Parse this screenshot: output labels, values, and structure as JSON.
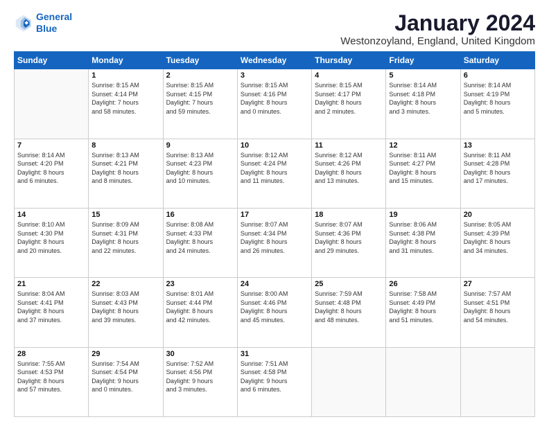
{
  "logo": {
    "line1": "General",
    "line2": "Blue"
  },
  "header": {
    "title": "January 2024",
    "location": "Westonzoyland, England, United Kingdom"
  },
  "weekdays": [
    "Sunday",
    "Monday",
    "Tuesday",
    "Wednesday",
    "Thursday",
    "Friday",
    "Saturday"
  ],
  "weeks": [
    [
      {
        "day": "",
        "sunrise": "",
        "sunset": "",
        "daylight": ""
      },
      {
        "day": "1",
        "sunrise": "Sunrise: 8:15 AM",
        "sunset": "Sunset: 4:14 PM",
        "daylight": "Daylight: 7 hours and 58 minutes."
      },
      {
        "day": "2",
        "sunrise": "Sunrise: 8:15 AM",
        "sunset": "Sunset: 4:15 PM",
        "daylight": "Daylight: 7 hours and 59 minutes."
      },
      {
        "day": "3",
        "sunrise": "Sunrise: 8:15 AM",
        "sunset": "Sunset: 4:16 PM",
        "daylight": "Daylight: 8 hours and 0 minutes."
      },
      {
        "day": "4",
        "sunrise": "Sunrise: 8:15 AM",
        "sunset": "Sunset: 4:17 PM",
        "daylight": "Daylight: 8 hours and 2 minutes."
      },
      {
        "day": "5",
        "sunrise": "Sunrise: 8:14 AM",
        "sunset": "Sunset: 4:18 PM",
        "daylight": "Daylight: 8 hours and 3 minutes."
      },
      {
        "day": "6",
        "sunrise": "Sunrise: 8:14 AM",
        "sunset": "Sunset: 4:19 PM",
        "daylight": "Daylight: 8 hours and 5 minutes."
      }
    ],
    [
      {
        "day": "7",
        "sunrise": "Sunrise: 8:14 AM",
        "sunset": "Sunset: 4:20 PM",
        "daylight": "Daylight: 8 hours and 6 minutes."
      },
      {
        "day": "8",
        "sunrise": "Sunrise: 8:13 AM",
        "sunset": "Sunset: 4:21 PM",
        "daylight": "Daylight: 8 hours and 8 minutes."
      },
      {
        "day": "9",
        "sunrise": "Sunrise: 8:13 AM",
        "sunset": "Sunset: 4:23 PM",
        "daylight": "Daylight: 8 hours and 10 minutes."
      },
      {
        "day": "10",
        "sunrise": "Sunrise: 8:12 AM",
        "sunset": "Sunset: 4:24 PM",
        "daylight": "Daylight: 8 hours and 11 minutes."
      },
      {
        "day": "11",
        "sunrise": "Sunrise: 8:12 AM",
        "sunset": "Sunset: 4:26 PM",
        "daylight": "Daylight: 8 hours and 13 minutes."
      },
      {
        "day": "12",
        "sunrise": "Sunrise: 8:11 AM",
        "sunset": "Sunset: 4:27 PM",
        "daylight": "Daylight: 8 hours and 15 minutes."
      },
      {
        "day": "13",
        "sunrise": "Sunrise: 8:11 AM",
        "sunset": "Sunset: 4:28 PM",
        "daylight": "Daylight: 8 hours and 17 minutes."
      }
    ],
    [
      {
        "day": "14",
        "sunrise": "Sunrise: 8:10 AM",
        "sunset": "Sunset: 4:30 PM",
        "daylight": "Daylight: 8 hours and 20 minutes."
      },
      {
        "day": "15",
        "sunrise": "Sunrise: 8:09 AM",
        "sunset": "Sunset: 4:31 PM",
        "daylight": "Daylight: 8 hours and 22 minutes."
      },
      {
        "day": "16",
        "sunrise": "Sunrise: 8:08 AM",
        "sunset": "Sunset: 4:33 PM",
        "daylight": "Daylight: 8 hours and 24 minutes."
      },
      {
        "day": "17",
        "sunrise": "Sunrise: 8:07 AM",
        "sunset": "Sunset: 4:34 PM",
        "daylight": "Daylight: 8 hours and 26 minutes."
      },
      {
        "day": "18",
        "sunrise": "Sunrise: 8:07 AM",
        "sunset": "Sunset: 4:36 PM",
        "daylight": "Daylight: 8 hours and 29 minutes."
      },
      {
        "day": "19",
        "sunrise": "Sunrise: 8:06 AM",
        "sunset": "Sunset: 4:38 PM",
        "daylight": "Daylight: 8 hours and 31 minutes."
      },
      {
        "day": "20",
        "sunrise": "Sunrise: 8:05 AM",
        "sunset": "Sunset: 4:39 PM",
        "daylight": "Daylight: 8 hours and 34 minutes."
      }
    ],
    [
      {
        "day": "21",
        "sunrise": "Sunrise: 8:04 AM",
        "sunset": "Sunset: 4:41 PM",
        "daylight": "Daylight: 8 hours and 37 minutes."
      },
      {
        "day": "22",
        "sunrise": "Sunrise: 8:03 AM",
        "sunset": "Sunset: 4:43 PM",
        "daylight": "Daylight: 8 hours and 39 minutes."
      },
      {
        "day": "23",
        "sunrise": "Sunrise: 8:01 AM",
        "sunset": "Sunset: 4:44 PM",
        "daylight": "Daylight: 8 hours and 42 minutes."
      },
      {
        "day": "24",
        "sunrise": "Sunrise: 8:00 AM",
        "sunset": "Sunset: 4:46 PM",
        "daylight": "Daylight: 8 hours and 45 minutes."
      },
      {
        "day": "25",
        "sunrise": "Sunrise: 7:59 AM",
        "sunset": "Sunset: 4:48 PM",
        "daylight": "Daylight: 8 hours and 48 minutes."
      },
      {
        "day": "26",
        "sunrise": "Sunrise: 7:58 AM",
        "sunset": "Sunset: 4:49 PM",
        "daylight": "Daylight: 8 hours and 51 minutes."
      },
      {
        "day": "27",
        "sunrise": "Sunrise: 7:57 AM",
        "sunset": "Sunset: 4:51 PM",
        "daylight": "Daylight: 8 hours and 54 minutes."
      }
    ],
    [
      {
        "day": "28",
        "sunrise": "Sunrise: 7:55 AM",
        "sunset": "Sunset: 4:53 PM",
        "daylight": "Daylight: 8 hours and 57 minutes."
      },
      {
        "day": "29",
        "sunrise": "Sunrise: 7:54 AM",
        "sunset": "Sunset: 4:54 PM",
        "daylight": "Daylight: 9 hours and 0 minutes."
      },
      {
        "day": "30",
        "sunrise": "Sunrise: 7:52 AM",
        "sunset": "Sunset: 4:56 PM",
        "daylight": "Daylight: 9 hours and 3 minutes."
      },
      {
        "day": "31",
        "sunrise": "Sunrise: 7:51 AM",
        "sunset": "Sunset: 4:58 PM",
        "daylight": "Daylight: 9 hours and 6 minutes."
      },
      {
        "day": "",
        "sunrise": "",
        "sunset": "",
        "daylight": ""
      },
      {
        "day": "",
        "sunrise": "",
        "sunset": "",
        "daylight": ""
      },
      {
        "day": "",
        "sunrise": "",
        "sunset": "",
        "daylight": ""
      }
    ]
  ]
}
